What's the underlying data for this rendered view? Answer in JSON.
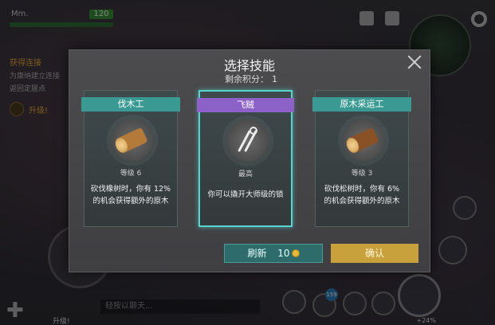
{
  "hud": {
    "player_name": "Mm.",
    "health": "120",
    "quest_title": "获得连接",
    "quest_desc": "为康纳建立连接",
    "quest_return": "返回定居点",
    "upgrade_label": "升级!",
    "upgrade_bottom": "升级!",
    "chat_placeholder": "轻按以聊天...",
    "inventory_badge": "159",
    "percent": "+24%"
  },
  "modal": {
    "title": "选择技能",
    "points_label": "剩余积分：",
    "points_value": "1",
    "cards": [
      {
        "name": "伐木工",
        "ribbon_color": "#3a9a93",
        "level": "等级 6",
        "description": "砍伐橡树时，你有 12% 的机会获得额外的原木",
        "icon": "log-icon",
        "selected": false
      },
      {
        "name": "飞贼",
        "ribbon_color": "#8c62c8",
        "level": "最高",
        "description": "你可以撬开大师级的锁",
        "icon": "lockpick-icon",
        "selected": true
      },
      {
        "name": "原木采运工",
        "ribbon_color": "#3a9a93",
        "level": "等级 3",
        "description": "砍伐松树时，你有 6% 的机会获得额外的原木",
        "icon": "log-icon",
        "selected": false
      }
    ],
    "refresh_label": "刷新",
    "refresh_cost": "10",
    "confirm_label": "确认"
  }
}
